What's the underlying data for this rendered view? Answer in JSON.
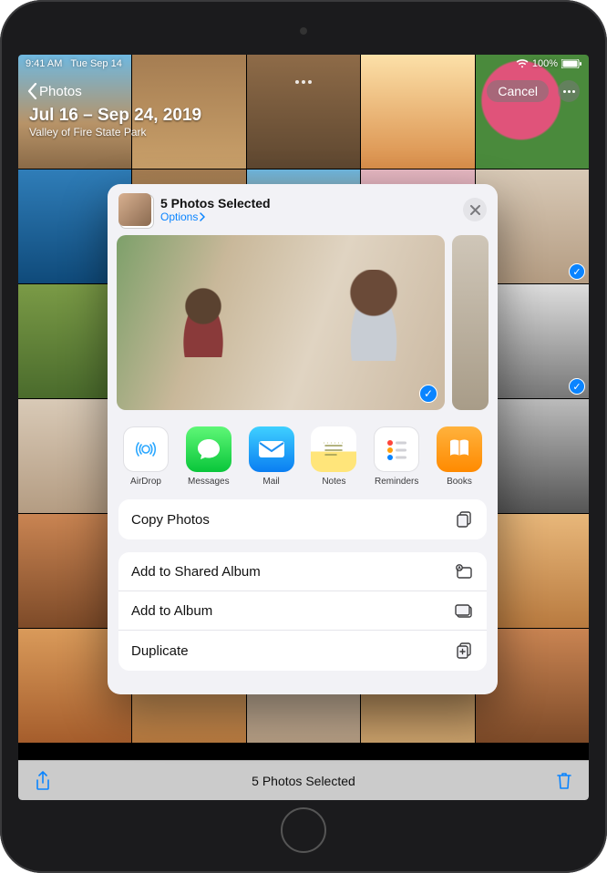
{
  "statusbar": {
    "time": "9:41 AM",
    "date": "Tue Sep 14",
    "battery": "100%"
  },
  "nav": {
    "back_label": "Photos",
    "cancel_label": "Cancel"
  },
  "header": {
    "date_range": "Jul 16 – Sep 24, 2019",
    "location": "Valley of Fire State Park"
  },
  "bottombar": {
    "status": "5 Photos Selected"
  },
  "sheet": {
    "title": "5 Photos Selected",
    "options_label": "Options",
    "apps": [
      {
        "id": "airdrop",
        "label": "AirDrop"
      },
      {
        "id": "messages",
        "label": "Messages"
      },
      {
        "id": "mail",
        "label": "Mail"
      },
      {
        "id": "notes",
        "label": "Notes"
      },
      {
        "id": "reminders",
        "label": "Reminders"
      },
      {
        "id": "books",
        "label": "Books"
      }
    ],
    "actions": [
      {
        "id": "copy",
        "label": "Copy Photos"
      },
      {
        "id": "sharedalbum",
        "label": "Add to Shared Album"
      },
      {
        "id": "album",
        "label": "Add to Album"
      },
      {
        "id": "duplicate",
        "label": "Duplicate"
      }
    ]
  },
  "colors": {
    "accent": "#0a84ff"
  }
}
